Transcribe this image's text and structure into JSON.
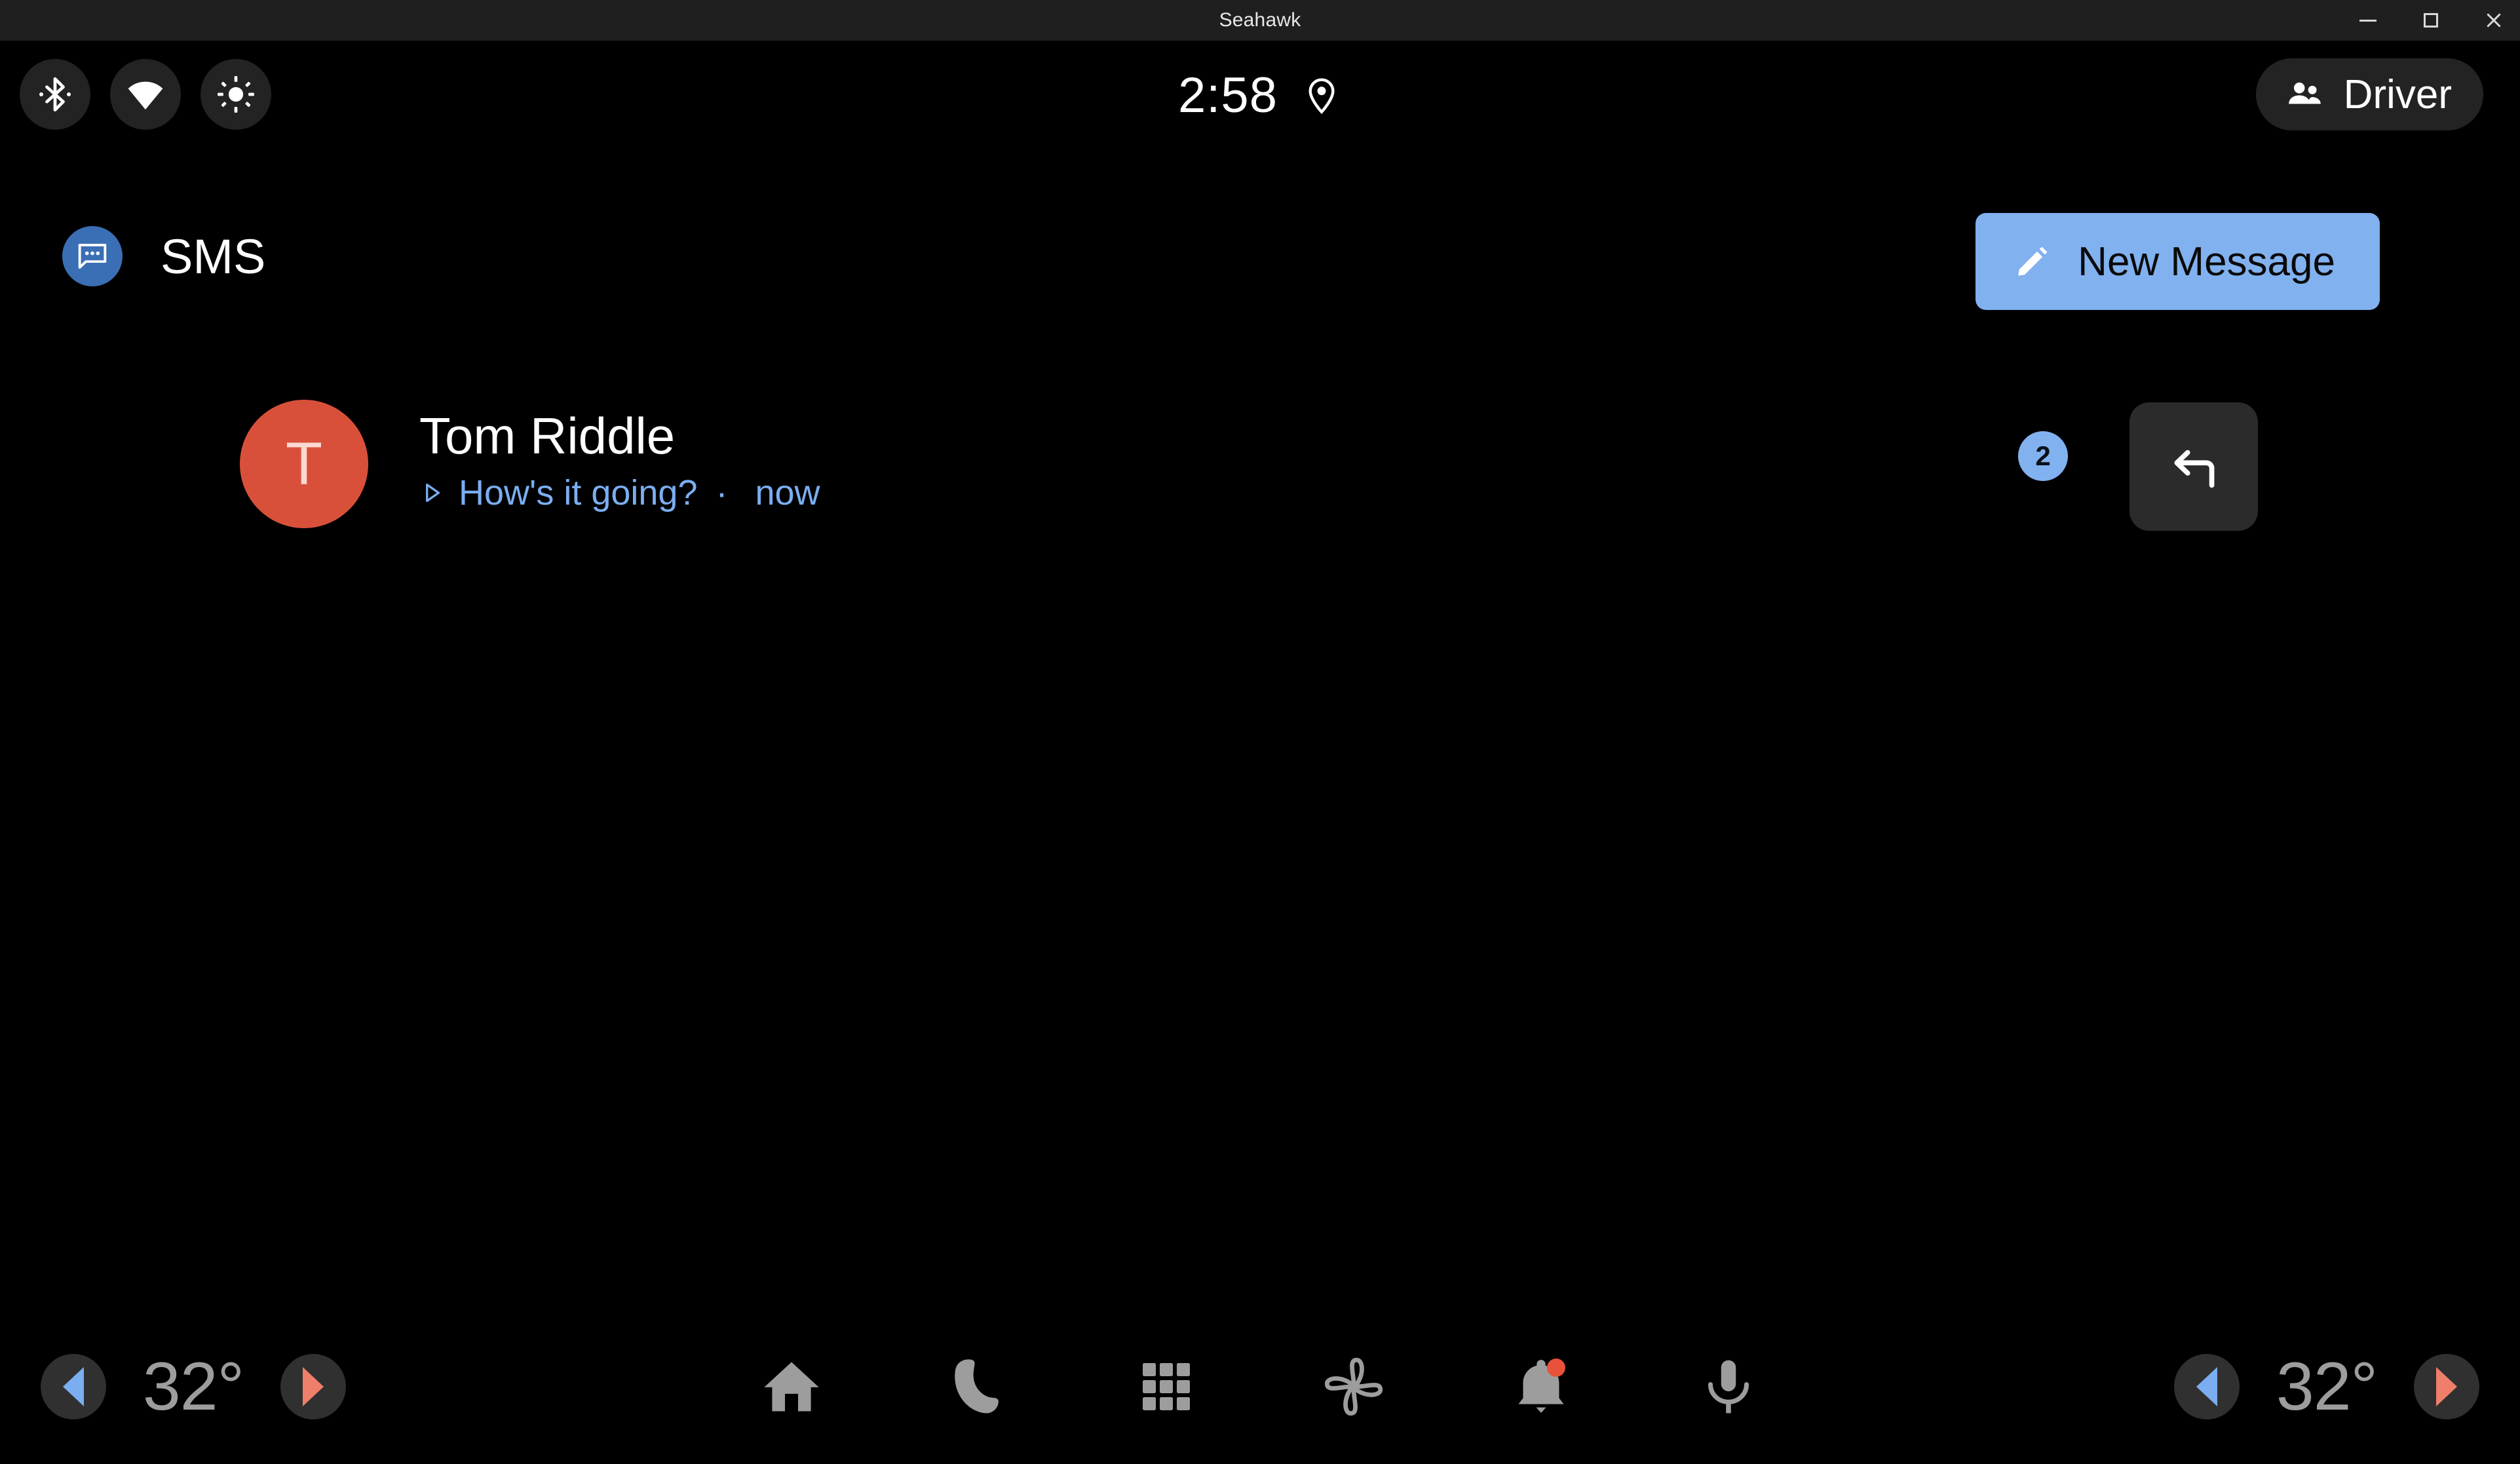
{
  "window": {
    "title": "Seahawk",
    "controls": {
      "minimize": "minimize",
      "maximize": "maximize",
      "close": "close"
    }
  },
  "status_bar": {
    "quick_toggles": [
      {
        "name": "bluetooth",
        "label": "Bluetooth"
      },
      {
        "name": "wifi",
        "label": "Wi-Fi"
      },
      {
        "name": "brightness",
        "label": "Brightness"
      }
    ],
    "clock": "2:58",
    "location_icon": "location-pin-icon",
    "user": {
      "label": "Driver",
      "icon": "people-icon"
    }
  },
  "app_header": {
    "icon": "sms-message-bubble-icon",
    "title": "SMS",
    "new_message": {
      "label": "New Message",
      "icon": "pencil-edit-icon",
      "background": "#81b1ef",
      "text_color": "#0a0a0a"
    }
  },
  "conversations": [
    {
      "avatar_initial": "T",
      "avatar_color": "#d8503a",
      "sender": "Tom Riddle",
      "preview_icon": "play-triangle-icon",
      "preview": "How's it going?",
      "separator": "·",
      "timestamp": "now",
      "preview_color": "#7aaef0",
      "unread_count": "2",
      "reply_icon": "reply-arrow-icon"
    }
  ],
  "nav_bar": {
    "climate_left": {
      "decrease_label": "decrease-temperature",
      "temperature": "32°",
      "increase_label": "increase-temperature"
    },
    "climate_right": {
      "decrease_label": "decrease-temperature",
      "temperature": "32°",
      "increase_label": "increase-temperature"
    },
    "buttons": [
      {
        "name": "home",
        "icon": "home-icon"
      },
      {
        "name": "phone",
        "icon": "phone-icon"
      },
      {
        "name": "apps",
        "icon": "apps-grid-icon"
      },
      {
        "name": "climate",
        "icon": "fan-icon"
      },
      {
        "name": "notifications",
        "icon": "bell-icon",
        "has_badge": true
      },
      {
        "name": "assistant",
        "icon": "microphone-icon"
      }
    ]
  },
  "colors": {
    "background": "#000000",
    "chip": "#232323",
    "accent_blue": "#81b1ef",
    "accent_red": "#d8503a",
    "nav_icon": "#9d9d9d"
  }
}
